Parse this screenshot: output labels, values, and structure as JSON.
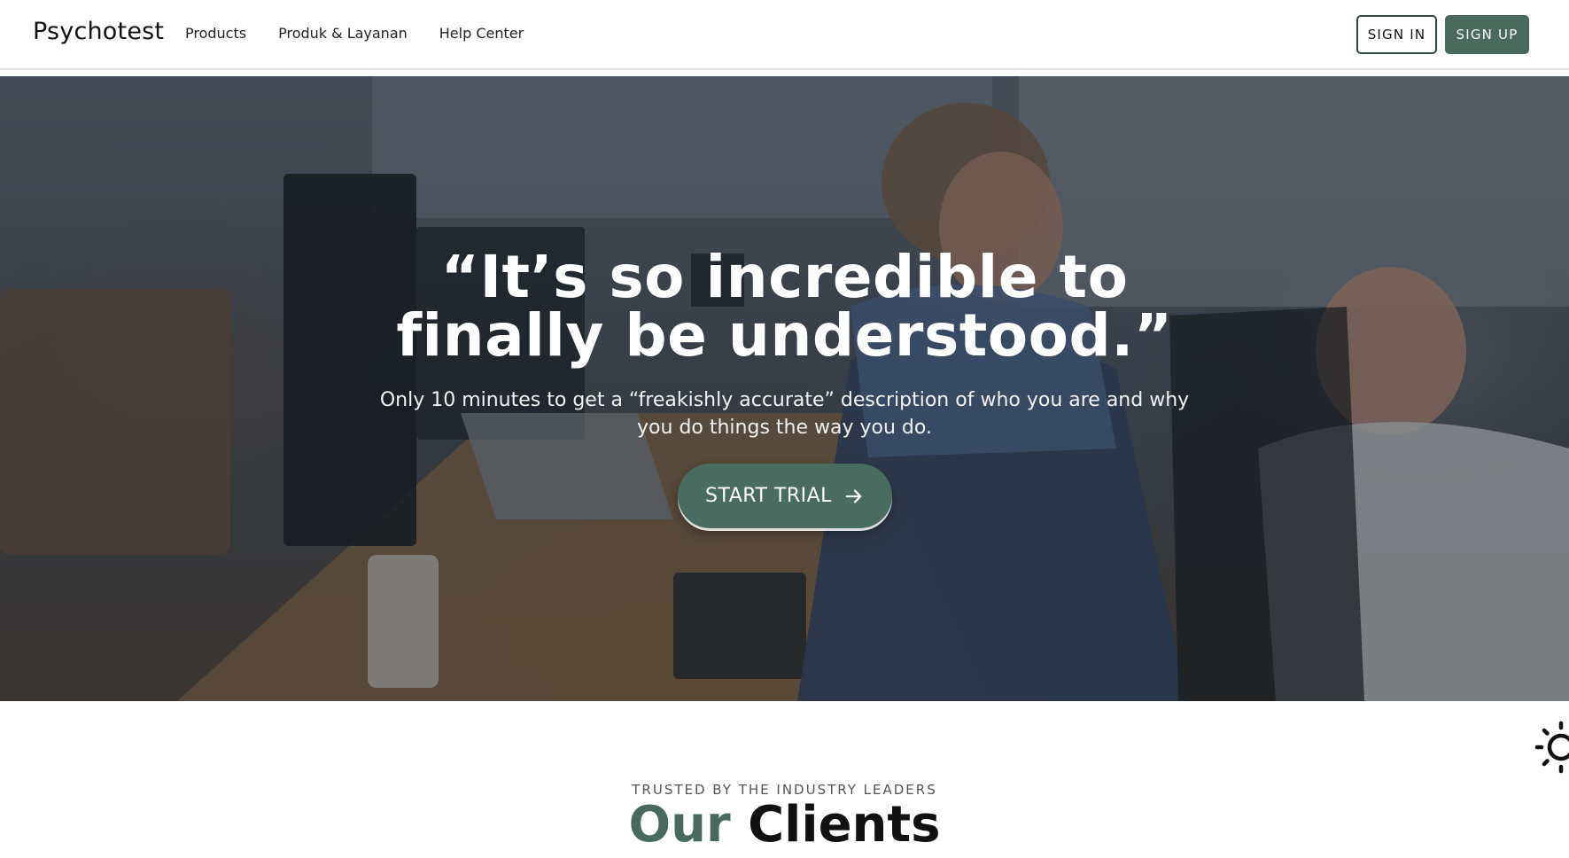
{
  "header": {
    "brand": "Psychotest",
    "nav": [
      {
        "label": "Products"
      },
      {
        "label": "Produk & Layanan"
      },
      {
        "label": "Help Center"
      }
    ],
    "sign_in": "SIGN IN",
    "sign_up": "SIGN UP"
  },
  "hero": {
    "title": "“It’s so incredible to finally be understood.”",
    "subtitle": "Only 10 minutes to get a “freakishly accurate” description of who you are and why you do things the way you do.",
    "cta_label": "START TRIAL",
    "cta_icon": "arrow-right-icon"
  },
  "clients": {
    "eyebrow": "TRUSTED BY THE INDUSTRY LEADERS",
    "heading_accent": "Our",
    "heading_rest": "Clients"
  },
  "colors": {
    "brand_green": "#48695c",
    "cta_green": "#4a6b5f",
    "header_border": "#dfe3e6"
  },
  "icons": {
    "spinner": "sun-spinner-icon"
  }
}
